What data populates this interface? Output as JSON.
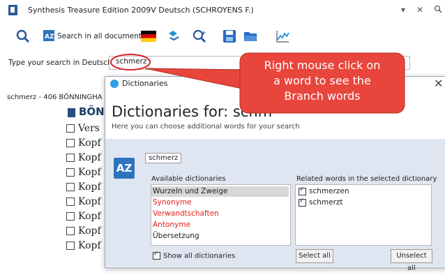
{
  "window": {
    "title": "Synthesis Treasure Edition 2009V Deutsch (SCHROYENS F.)",
    "minimize_glyph": "▾",
    "close_glyph": "✕",
    "extra_glyph": "🔍"
  },
  "toolbar": {
    "search_all_label": "Search in all documents",
    "icons": [
      "search-icon",
      "az-search-icon",
      "german-flag-icon",
      "hierarchy-icon",
      "zoom-plus-icon",
      "save-icon",
      "open-folder-icon",
      "chart-icon"
    ]
  },
  "search": {
    "label": "Type your search in Deutsch",
    "value": "schmerz"
  },
  "results": {
    "header": "schmerz - 406  BÖNNINGHA",
    "title": "BÖN",
    "items": [
      "Vers",
      "Kopf",
      "Kopf",
      "Kopf",
      "Kopf",
      "Kopf",
      "Kopf",
      "Kopf",
      "Kopf"
    ]
  },
  "dialog": {
    "title": "Dictionaries",
    "close_glyph": "✕",
    "heading": "Dictionaries for: schm",
    "subtitle": "Here you can choose additional words for your search",
    "word_chip": "schmerz",
    "available_label": "Available dictionaries",
    "related_label": "Related words in the selected dictionary",
    "dictionaries": [
      {
        "label": "Wurzeln und Zweige",
        "color": "#222222",
        "selected": true
      },
      {
        "label": "Synonyme",
        "color": "#e02020",
        "selected": false
      },
      {
        "label": "Verwandtschaften",
        "color": "#e02020",
        "selected": false
      },
      {
        "label": "Antonyme",
        "color": "#e02020",
        "selected": false
      },
      {
        "label": "Übersetzung",
        "color": "#222222",
        "selected": false
      }
    ],
    "related_words": [
      {
        "label": "schmerzen",
        "checked": true
      },
      {
        "label": "schmerzt",
        "checked": true
      }
    ],
    "show_all_label": "Show all dictionaries",
    "select_all_label": "Select all",
    "unselect_all_label": "Unselect all"
  },
  "callout": {
    "line1": "Right mouse click on",
    "line2": "a word to see the",
    "line3": "Branch words",
    "fill": "#e8463c"
  }
}
